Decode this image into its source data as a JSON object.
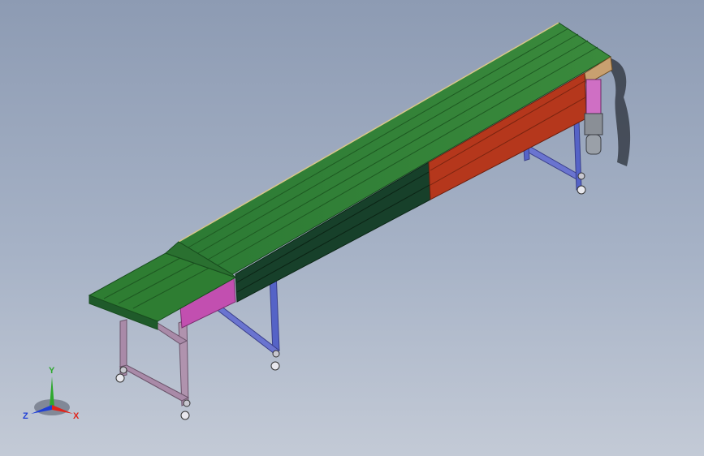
{
  "viewport": {
    "background_top": "#8d9bb3",
    "background_bottom": "#c3cad6"
  },
  "model": {
    "belt_color": "#2e7d32",
    "belt_dark_color": "#1f5a2a",
    "frame_red_color": "#b5371c",
    "frame_dark_green_color": "#17402a",
    "bracket_magenta_color": "#c24fb0",
    "leg_blue_color": "#5563c7",
    "leg_mauve_color": "#a98aa8",
    "motor_pink_color": "#cf6fc4",
    "motor_gray_color": "#8a8f96"
  },
  "triad": {
    "x_label": "X",
    "y_label": "Y",
    "z_label": "Z",
    "x_color": "#e0241b",
    "y_color": "#2ea82e",
    "z_color": "#1f3fd6"
  }
}
